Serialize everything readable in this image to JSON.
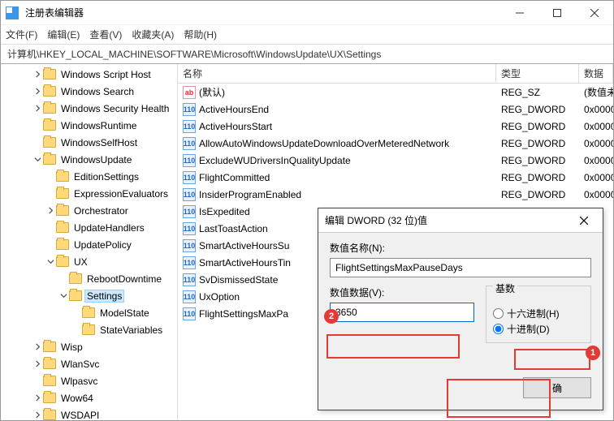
{
  "window": {
    "title": "注册表编辑器"
  },
  "menu": {
    "file": "文件(F)",
    "edit": "编辑(E)",
    "view": "查看(V)",
    "fav": "收藏夹(A)",
    "help": "帮助(H)"
  },
  "address": "计算机\\HKEY_LOCAL_MACHINE\\SOFTWARE\\Microsoft\\WindowsUpdate\\UX\\Settings",
  "columns": {
    "name": "名称",
    "type": "类型",
    "data": "数据"
  },
  "tree": [
    {
      "pad": 2,
      "tw": ">",
      "label": "Windows Script Host"
    },
    {
      "pad": 2,
      "tw": ">",
      "label": "Windows Search"
    },
    {
      "pad": 2,
      "tw": ">",
      "label": "Windows Security Health"
    },
    {
      "pad": 2,
      "tw": "",
      "label": "WindowsRuntime"
    },
    {
      "pad": 2,
      "tw": "",
      "label": "WindowsSelfHost"
    },
    {
      "pad": 2,
      "tw": "v",
      "label": "WindowsUpdate"
    },
    {
      "pad": 3,
      "tw": "",
      "label": "EditionSettings"
    },
    {
      "pad": 3,
      "tw": "",
      "label": "ExpressionEvaluators"
    },
    {
      "pad": 3,
      "tw": ">",
      "label": "Orchestrator"
    },
    {
      "pad": 3,
      "tw": "",
      "label": "UpdateHandlers"
    },
    {
      "pad": 3,
      "tw": "",
      "label": "UpdatePolicy"
    },
    {
      "pad": 3,
      "tw": "v",
      "label": "UX"
    },
    {
      "pad": 4,
      "tw": "",
      "label": "RebootDowntime"
    },
    {
      "pad": 4,
      "tw": "v",
      "label": "Settings",
      "sel": true
    },
    {
      "pad": 5,
      "tw": "",
      "label": "ModelState"
    },
    {
      "pad": 5,
      "tw": "",
      "label": "StateVariables"
    },
    {
      "pad": 2,
      "tw": ">",
      "label": "Wisp"
    },
    {
      "pad": 2,
      "tw": ">",
      "label": "WlanSvc"
    },
    {
      "pad": 2,
      "tw": "",
      "label": "Wlpasvc"
    },
    {
      "pad": 2,
      "tw": ">",
      "label": "Wow64"
    },
    {
      "pad": 2,
      "tw": ">",
      "label": "WSDAPI"
    }
  ],
  "values": [
    {
      "icon": "str",
      "name": "(默认)",
      "type": "REG_SZ",
      "data": "(数值未"
    },
    {
      "icon": "dw",
      "name": "ActiveHoursEnd",
      "type": "REG_DWORD",
      "data": "0x0000"
    },
    {
      "icon": "dw",
      "name": "ActiveHoursStart",
      "type": "REG_DWORD",
      "data": "0x0000"
    },
    {
      "icon": "dw",
      "name": "AllowAutoWindowsUpdateDownloadOverMeteredNetwork",
      "type": "REG_DWORD",
      "data": "0x0000"
    },
    {
      "icon": "dw",
      "name": "ExcludeWUDriversInQualityUpdate",
      "type": "REG_DWORD",
      "data": "0x0000"
    },
    {
      "icon": "dw",
      "name": "FlightCommitted",
      "type": "REG_DWORD",
      "data": "0x0000"
    },
    {
      "icon": "dw",
      "name": "InsiderProgramEnabled",
      "type": "REG_DWORD",
      "data": "0x0000"
    },
    {
      "icon": "dw",
      "name": "IsExpedited",
      "type": "",
      "data": ""
    },
    {
      "icon": "dw",
      "name": "LastToastAction",
      "type": "",
      "data": ""
    },
    {
      "icon": "dw",
      "name": "SmartActiveHoursSu",
      "type": "",
      "data": ""
    },
    {
      "icon": "dw",
      "name": "SmartActiveHoursTin",
      "type": "",
      "data": ""
    },
    {
      "icon": "dw",
      "name": "SvDismissedState",
      "type": "",
      "data": ""
    },
    {
      "icon": "dw",
      "name": "UxOption",
      "type": "",
      "data": ""
    },
    {
      "icon": "dw",
      "name": "FlightSettingsMaxPa",
      "type": "",
      "data": ""
    }
  ],
  "dialog": {
    "title": "编辑 DWORD (32 位)值",
    "name_label": "数值名称(N):",
    "name_value": "FlightSettingsMaxPauseDays",
    "data_label": "数值数据(V):",
    "data_value": "3650",
    "base_label": "基数",
    "hex_label": "十六进制(H)",
    "dec_label": "十进制(D)",
    "ok_label": "确"
  },
  "callouts": {
    "b1": "1",
    "b2": "2"
  }
}
